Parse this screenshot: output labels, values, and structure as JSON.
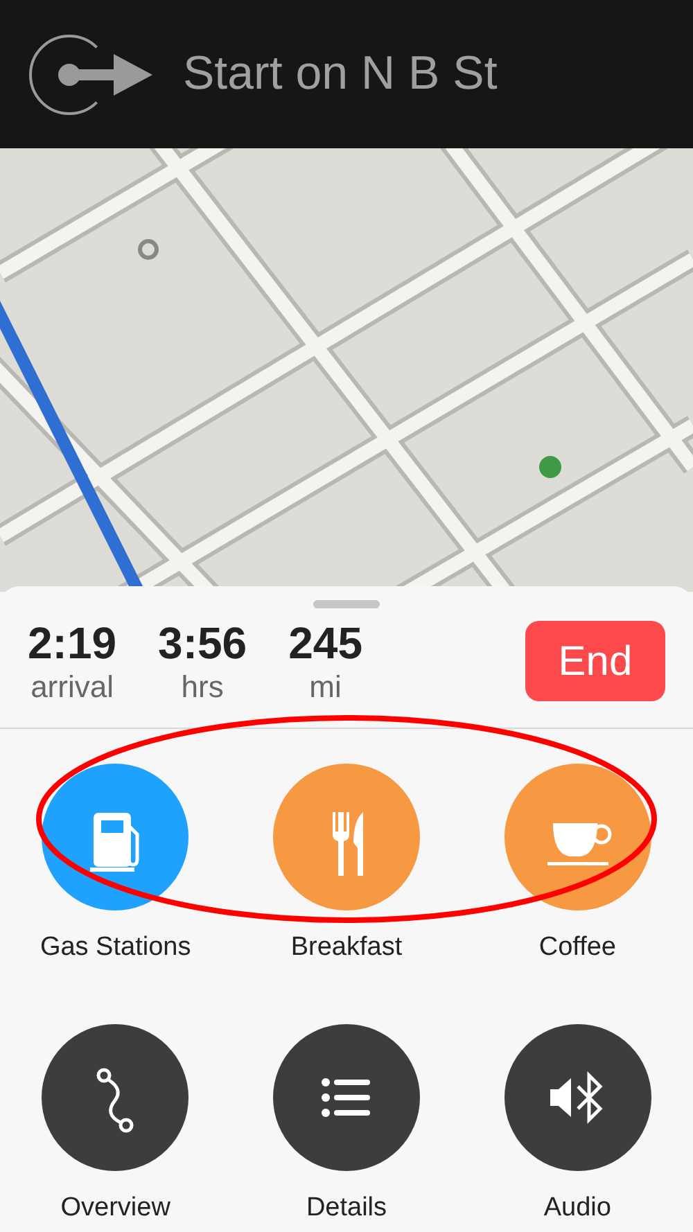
{
  "banner": {
    "instruction": "Start on N B St"
  },
  "trip": {
    "stats": [
      {
        "value": "2:19",
        "label": "arrival"
      },
      {
        "value": "3:56",
        "label": "hrs"
      },
      {
        "value": "245",
        "label": "mi"
      }
    ],
    "end_button": "End"
  },
  "categories": [
    {
      "kind": "gas",
      "label": "Gas Stations",
      "color": "#1fa2fd"
    },
    {
      "kind": "food",
      "label": "Breakfast",
      "color": "#f79842"
    },
    {
      "kind": "coffee",
      "label": "Coffee",
      "color": "#f79842"
    }
  ],
  "actions": [
    {
      "kind": "route",
      "label": "Overview"
    },
    {
      "kind": "list",
      "label": "Details"
    },
    {
      "kind": "audio",
      "label": "Audio"
    }
  ]
}
